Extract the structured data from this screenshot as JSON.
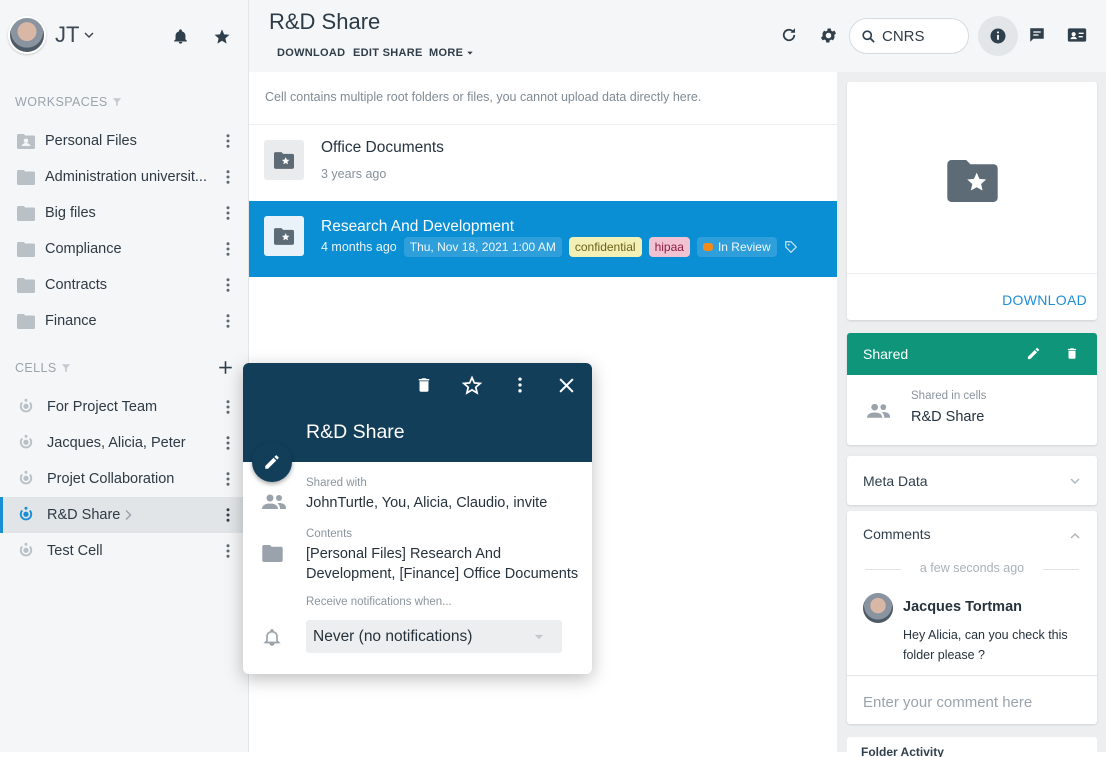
{
  "user": {
    "initials": "JT"
  },
  "sidebar": {
    "workspaces_label": "WORKSPACES",
    "workspaces": [
      {
        "label": "Personal Files",
        "icon": "personal-folder-icon"
      },
      {
        "label": "Administration universit...",
        "icon": "folder-icon"
      },
      {
        "label": "Big files",
        "icon": "folder-icon"
      },
      {
        "label": "Compliance",
        "icon": "folder-icon"
      },
      {
        "label": "Contracts",
        "icon": "folder-icon"
      },
      {
        "label": "Finance",
        "icon": "folder-icon"
      }
    ],
    "cells_label": "CELLS",
    "cells": [
      {
        "label": "For Project Team",
        "icon": "cell-icon"
      },
      {
        "label": "Jacques, Alicia, Peter",
        "icon": "cell-icon"
      },
      {
        "label": "Projet Collaboration",
        "icon": "cell-icon"
      },
      {
        "label": "R&D Share",
        "icon": "cell-icon",
        "active": true
      },
      {
        "label": "Test Cell",
        "icon": "cell-icon"
      }
    ]
  },
  "header": {
    "title": "R&D Share",
    "actions": {
      "download": "DOWNLOAD",
      "edit_share": "EDIT SHARE",
      "more": "MORE"
    },
    "search_value": "CNRS"
  },
  "main": {
    "notice": "Cell contains multiple root folders or files, you cannot upload data directly here.",
    "rows": [
      {
        "name": "Office Documents",
        "modified": "3 years ago"
      },
      {
        "name": "Research And Development",
        "modified": "4 months ago",
        "date": "Thu, Nov 18, 2021 1:00 AM",
        "tags": [
          "confidential",
          "hipaa"
        ],
        "status": "In Review"
      }
    ]
  },
  "right_panel": {
    "download": "DOWNLOAD",
    "shared": {
      "title": "Shared",
      "label": "Shared in cells",
      "value": "R&D Share"
    },
    "meta_title": "Meta Data",
    "comments": {
      "title": "Comments",
      "time": "a few seconds ago",
      "author": "Jacques Tortman",
      "text": "Hey Alicia, can you check this folder please ?",
      "input_placeholder": "Enter your comment here"
    },
    "folder_activity_label": "Folder Activity"
  },
  "popover": {
    "title": "R&D Share",
    "shared_with_label": "Shared with",
    "shared_with": "JohnTurtle, You, Alicia, Claudio, invite",
    "contents_label": "Contents",
    "contents": "[Personal Files] Research And Development, [Finance] Office Documents",
    "notify_label": "Receive notifications when...",
    "notify_value": "Never (no notifications)"
  },
  "colors": {
    "accent": "#0a8ed4",
    "popover_header": "#123e5a",
    "shared_header": "#0f967a"
  }
}
